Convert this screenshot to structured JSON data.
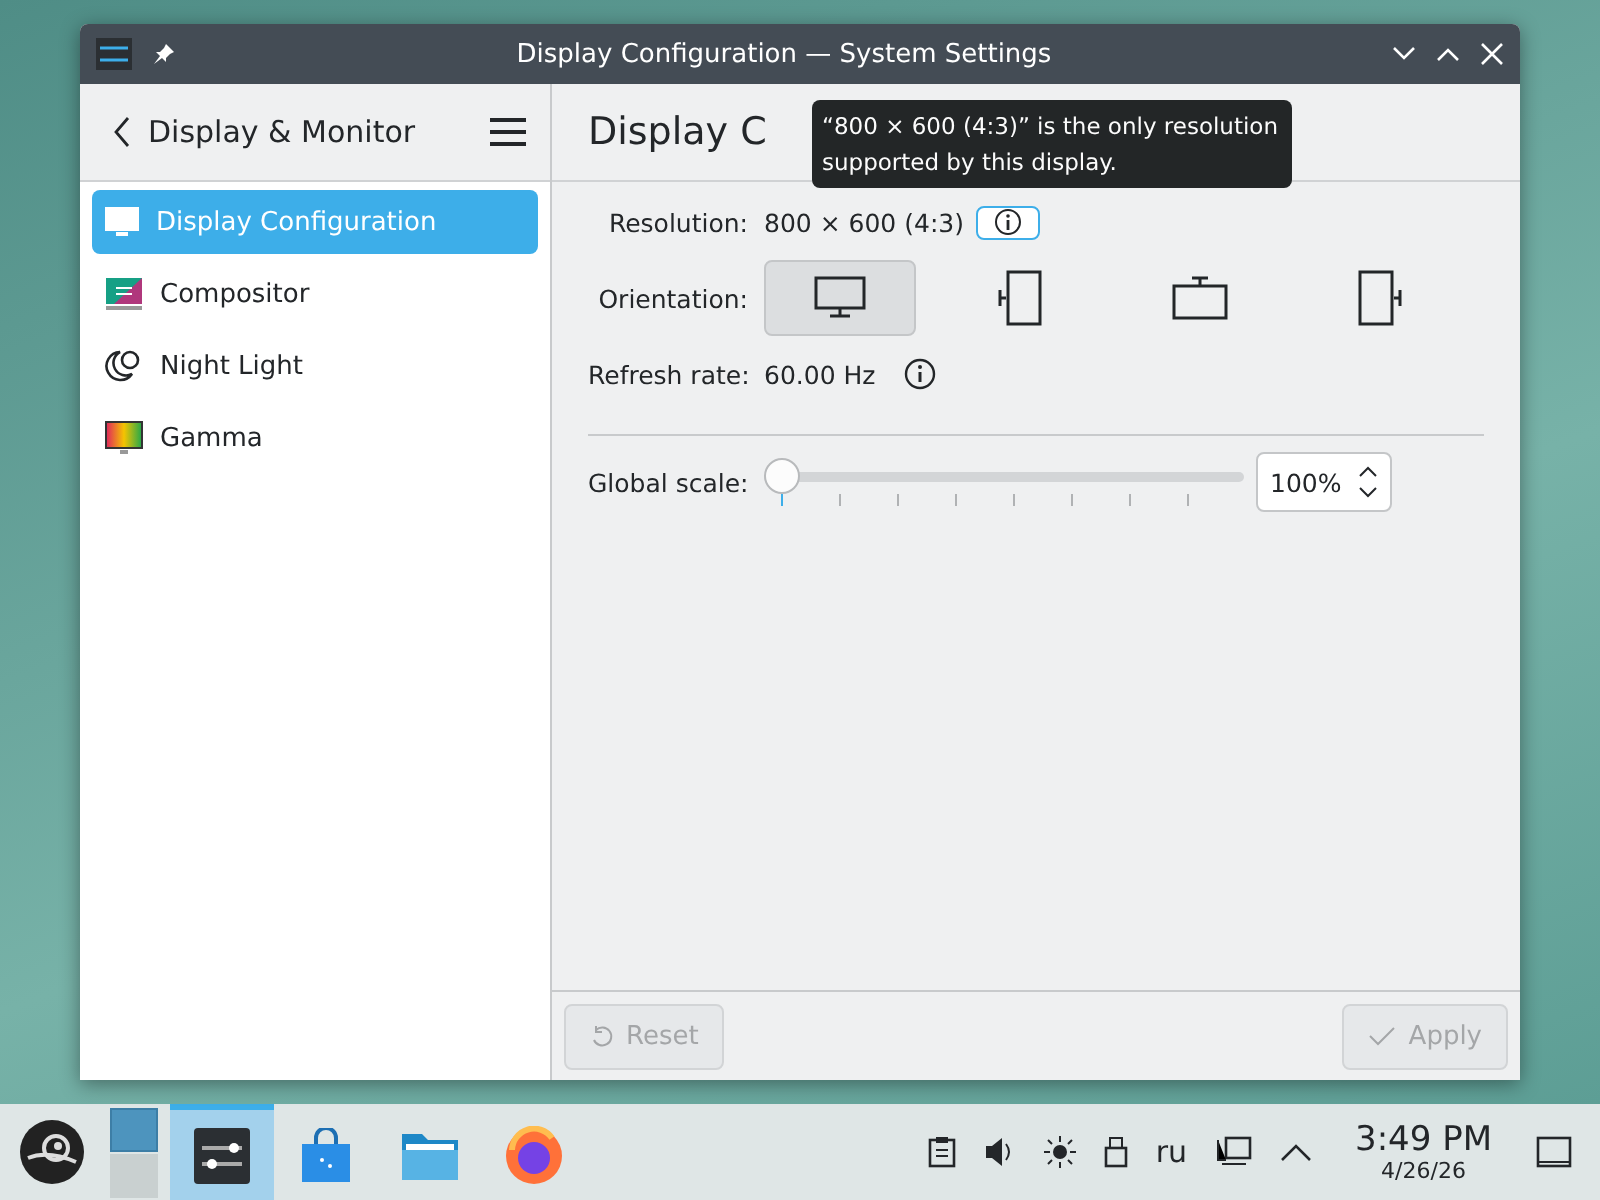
{
  "window": {
    "title": "Display Configuration — System Settings"
  },
  "header": {
    "back_label": "Display & Monitor",
    "page_title": "Display C"
  },
  "tooltip": {
    "text": "“800 × 600 (4:3)” is the only resolution supported by this display."
  },
  "sidebar": {
    "items": [
      {
        "label": "Display Configuration",
        "kind": "display",
        "selected": true
      },
      {
        "label": "Compositor",
        "kind": "compositor",
        "selected": false
      },
      {
        "label": "Night Light",
        "kind": "night",
        "selected": false
      },
      {
        "label": "Gamma",
        "kind": "gamma",
        "selected": false
      }
    ]
  },
  "resolution": {
    "label": "Resolution:",
    "value": "800 × 600 (4:3)"
  },
  "orientation": {
    "label": "Orientation:",
    "options": [
      {
        "kind": "normal",
        "selected": true
      },
      {
        "kind": "left",
        "selected": false
      },
      {
        "kind": "inverted",
        "selected": false
      },
      {
        "kind": "right",
        "selected": false
      }
    ]
  },
  "refresh": {
    "label": "Refresh rate:",
    "value": "60.00 Hz"
  },
  "scale": {
    "label": "Global scale:",
    "level": 0,
    "value": "100%"
  },
  "footer": {
    "buttons": [
      {
        "label": "Reset",
        "kind": "reset",
        "disabled": true
      },
      {
        "label": "Apply",
        "kind": "apply",
        "disabled": true
      }
    ]
  },
  "taskbar": {
    "tasks": [
      {
        "kind": "settings",
        "selected": true
      },
      {
        "kind": "store",
        "selected": false
      },
      {
        "kind": "files",
        "selected": false
      },
      {
        "kind": "browser",
        "selected": false
      }
    ],
    "keyboard_layout": "ru",
    "time": "3:49 PM",
    "date": "4/26/26"
  }
}
